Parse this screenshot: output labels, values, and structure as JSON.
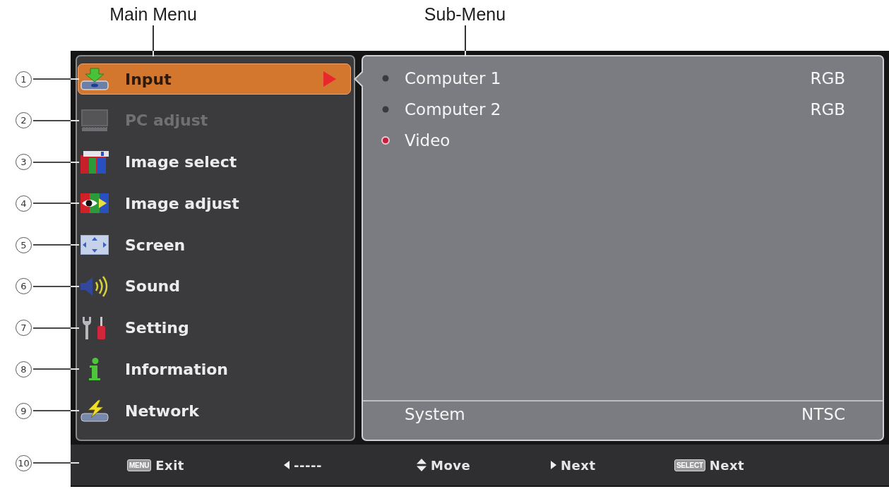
{
  "labels": {
    "main_menu": "Main Menu",
    "sub_menu": "Sub-Menu"
  },
  "main_menu": {
    "items": [
      {
        "callout": "1",
        "label": "Input",
        "selected": true,
        "disabled": false
      },
      {
        "callout": "2",
        "label": "PC adjust",
        "selected": false,
        "disabled": true
      },
      {
        "callout": "3",
        "label": "Image select",
        "selected": false,
        "disabled": false
      },
      {
        "callout": "4",
        "label": "Image adjust",
        "selected": false,
        "disabled": false
      },
      {
        "callout": "5",
        "label": "Screen",
        "selected": false,
        "disabled": false
      },
      {
        "callout": "6",
        "label": "Sound",
        "selected": false,
        "disabled": false
      },
      {
        "callout": "7",
        "label": "Setting",
        "selected": false,
        "disabled": false
      },
      {
        "callout": "8",
        "label": "Information",
        "selected": false,
        "disabled": false
      },
      {
        "callout": "9",
        "label": "Network",
        "selected": false,
        "disabled": false
      }
    ]
  },
  "sub_menu": {
    "items": [
      {
        "label": "Computer 1",
        "value": "RGB",
        "selected": false
      },
      {
        "label": "Computer 2",
        "value": "RGB",
        "selected": false
      },
      {
        "label": "Video",
        "selected": true
      }
    ],
    "footer": {
      "label": "System",
      "value": "NTSC"
    }
  },
  "guide_bar": {
    "callout": "10",
    "hints": [
      {
        "kind": "key",
        "key": "MENU",
        "label": "Exit"
      },
      {
        "kind": "left",
        "label": "-----"
      },
      {
        "kind": "updown",
        "label": "Move"
      },
      {
        "kind": "right",
        "label": "Next"
      },
      {
        "kind": "key",
        "key": "SELECT",
        "label": "Next"
      }
    ]
  }
}
